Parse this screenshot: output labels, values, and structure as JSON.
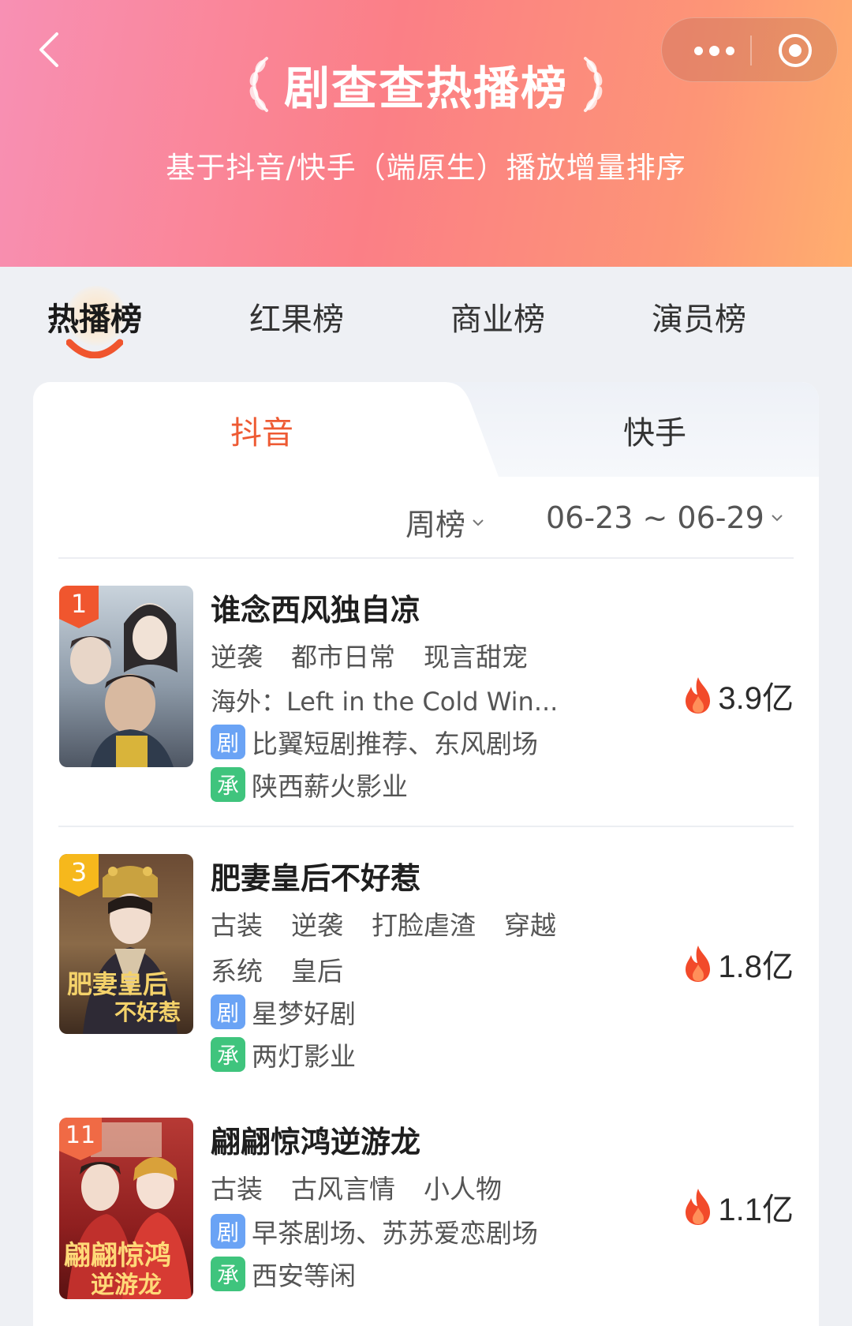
{
  "header": {
    "title": "剧查查热播榜",
    "subtitle": "基于抖音/快手（端原生）播放增量排序",
    "gradient_colors": [
      "#f890b4",
      "#fb7f86",
      "#ffae6e"
    ]
  },
  "main_tabs": [
    {
      "label": "热播榜",
      "active": true
    },
    {
      "label": "红果榜",
      "active": false
    },
    {
      "label": "商业榜",
      "active": false
    },
    {
      "label": "演员榜",
      "active": false
    }
  ],
  "platform_tabs": [
    {
      "label": "抖音",
      "active": true
    },
    {
      "label": "快手",
      "active": false
    }
  ],
  "filters": {
    "period": "周榜",
    "date_range": "06-23 ~ 06-29"
  },
  "accent_color": "#ee5a33",
  "items": [
    {
      "rank": "1",
      "rank_color": "#f0562e",
      "title": "谁念西风独自凉",
      "tags": [
        "逆袭",
        "都市日常",
        "现言甜宠"
      ],
      "overseas": "海外：Left in the Cold Win...",
      "platform_chip": "剧",
      "platform": "比翼短剧推荐、东风剧场",
      "producer_chip": "承",
      "producer": "陕西薪火影业",
      "heat": "3.9亿",
      "poster_text": "谁念西风独自凉"
    },
    {
      "rank": "3",
      "rank_color": "#f6b81c",
      "title": "肥妻皇后不好惹",
      "tags": [
        "古装",
        "逆袭",
        "打脸虐渣",
        "穿越"
      ],
      "tags2": [
        "系统",
        "皇后"
      ],
      "platform_chip": "剧",
      "platform": "星梦好剧",
      "producer_chip": "承",
      "producer": "两灯影业",
      "heat": "1.8亿",
      "poster_text_1": "肥妻皇后",
      "poster_text_2": "不好惹"
    },
    {
      "rank": "11",
      "rank_color": "#f06a45",
      "title": "翩翩惊鸿逆游龙",
      "tags": [
        "古装",
        "古风言情",
        "小人物"
      ],
      "platform_chip": "剧",
      "platform": "早茶剧场、苏苏爱恋剧场",
      "producer_chip": "承",
      "producer": "西安等闲",
      "heat": "1.1亿",
      "poster_text_1": "翩翩惊鸿",
      "poster_text_2": "逆游龙"
    }
  ]
}
